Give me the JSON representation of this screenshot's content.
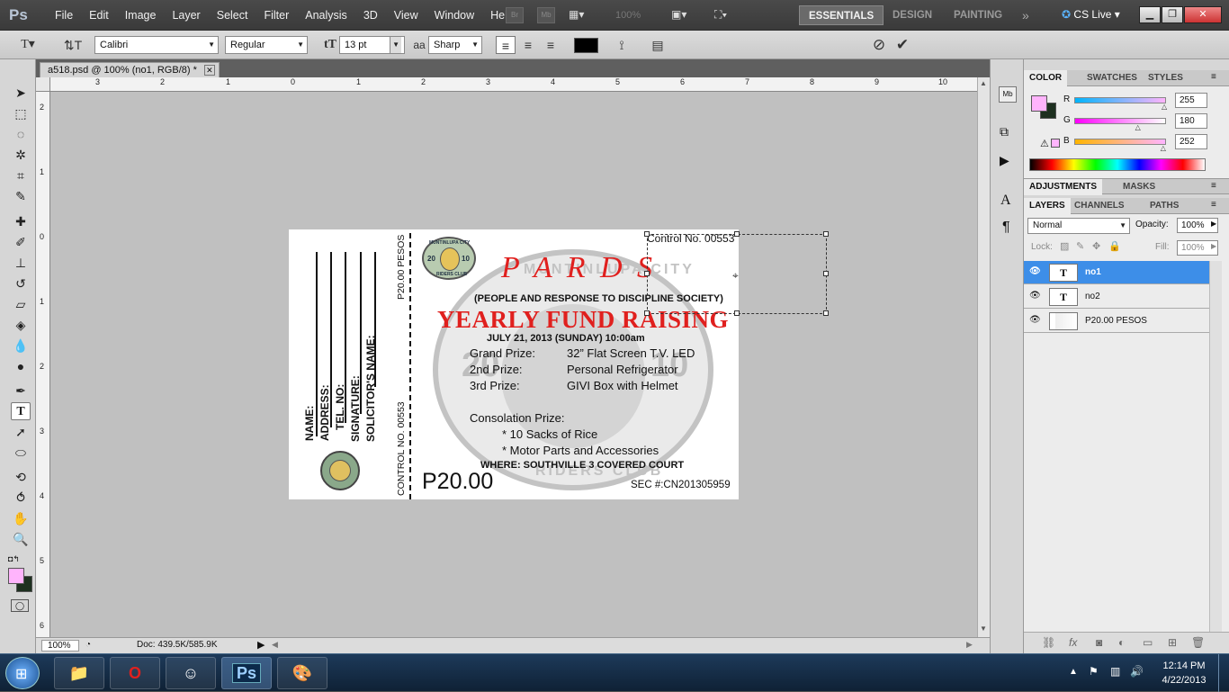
{
  "menubar": {
    "logo": "Ps",
    "items": [
      "File",
      "Edit",
      "Image",
      "Layer",
      "Select",
      "Filter",
      "Analysis",
      "3D",
      "View",
      "Window",
      "Help"
    ],
    "zoom": "100%",
    "workspaces": [
      "ESSENTIALS",
      "DESIGN",
      "PAINTING"
    ],
    "cs_live": "CS Live"
  },
  "options": {
    "font_family": "Calibri",
    "font_style": "Regular",
    "font_size": "13 pt",
    "aa_label": "a",
    "antialias": "Sharp"
  },
  "document": {
    "tab_title": "a518.psd @ 100% (no1, RGB/8) *"
  },
  "ruler": {
    "top": [
      "3",
      "2",
      "1",
      "0",
      "1",
      "2",
      "3",
      "4",
      "5",
      "6",
      "7",
      "8",
      "9",
      "10"
    ],
    "left": [
      "2",
      "1",
      "0",
      "1",
      "2",
      "3",
      "4",
      "5",
      "6"
    ]
  },
  "status": {
    "zoom": "100%",
    "doc": "Doc: 439.5K/585.9K"
  },
  "ticket": {
    "stub_fields": [
      "NAME:",
      "ADDRESS:",
      "TEL. NO:",
      "SIGNATURE:",
      "SOLICITOR'S NAME:"
    ],
    "stub_price_vertical": "P20.00 PESOS",
    "stub_control_vertical": "CONTROL NO. 00553",
    "control_no": "Control No. 00553",
    "org": "P A R D S",
    "org_full": "(PEOPLE AND RESPONSE TO DISCIPLINE SOCIETY)",
    "event": "YEARLY FUND RAISING",
    "date": "JULY 21, 2013 (SUNDAY) 10:00am",
    "prizes": [
      {
        "label": "Grand Prize:",
        "value": "32” Flat Screen T.V. LED"
      },
      {
        "label": "2nd Prize:",
        "value": "Personal Refrigerator"
      },
      {
        "label": "3rd Prize:",
        "value": "GIVI Box with Helmet"
      }
    ],
    "consolation_label": "Consolation Prize:",
    "consolation": [
      "* 10 Sacks of Rice",
      "* Motor Parts and Accessories"
    ],
    "where": "WHERE: SOUTHVILLE 3 COVERED COURT",
    "price": "P20.00",
    "sec": "SEC #:CN201305959",
    "watermark_left": "20",
    "watermark_right": "10",
    "seal_top": "MUNTINLUPA CITY",
    "seal_year_left": "20",
    "seal_year_right": "10",
    "seal_bottom": "RIDERS CLUB",
    "watermark_top": "MUNTINLUPA CITY",
    "watermark_bottom": "RIDERS CLUB"
  },
  "panels": {
    "color_tabs": [
      "COLOR",
      "SWATCHES",
      "STYLES"
    ],
    "rgb": [
      {
        "label": "R",
        "value": "255",
        "level": 1.0
      },
      {
        "label": "G",
        "value": "180",
        "level": 0.706
      },
      {
        "label": "B",
        "value": "252",
        "level": 0.988
      }
    ],
    "fg_color": "#ffb4fc",
    "bg_color": "#1e3020",
    "adj_tabs": [
      "ADJUSTMENTS",
      "MASKS"
    ],
    "layer_tabs": [
      "LAYERS",
      "CHANNELS",
      "PATHS"
    ],
    "blend_mode": "Normal",
    "opacity_label": "Opacity:",
    "opacity": "100%",
    "lock_label": "Lock:",
    "fill_label": "Fill:",
    "fill": "100%",
    "layers": [
      {
        "name": "no1",
        "thumb": "T",
        "selected": true
      },
      {
        "name": "no2",
        "thumb": "T",
        "selected": false
      },
      {
        "name": "P20.00 PESOS",
        "thumb": "",
        "selected": false
      }
    ]
  },
  "taskbar": {
    "time": "12:14 PM",
    "date": "4/22/2013",
    "ps_label": "Ps"
  },
  "colors": {
    "accent_red": "#e0201e",
    "selection_blue": "#3d8ee8"
  }
}
